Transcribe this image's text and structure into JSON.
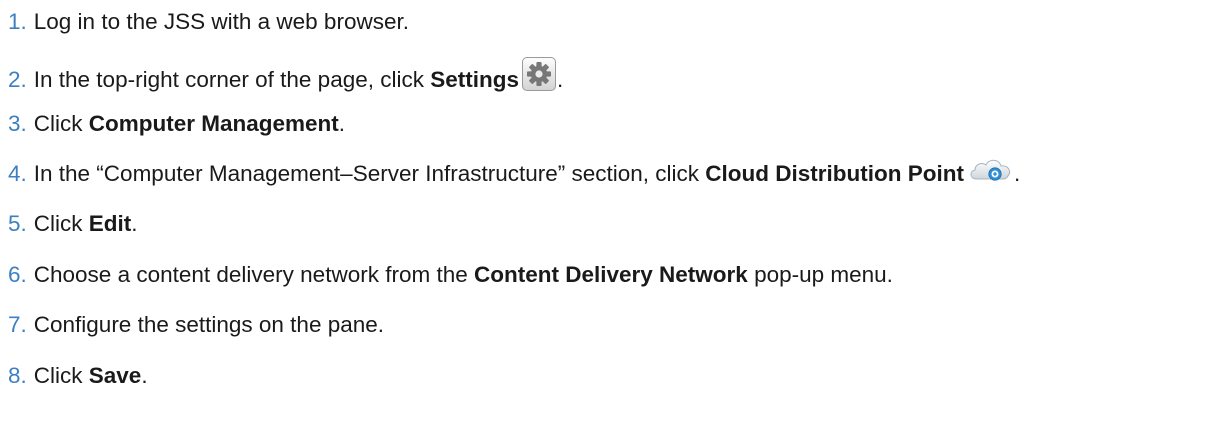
{
  "steps": [
    {
      "num": "1.",
      "parts": {
        "a": "Log in to the JSS with a web browser."
      }
    },
    {
      "num": "2.",
      "parts": {
        "a": "In the top-right corner of the page, click ",
        "b": "Settings",
        "c": "."
      }
    },
    {
      "num": "3.",
      "parts": {
        "a": "Click ",
        "b": "Computer Management",
        "c": "."
      }
    },
    {
      "num": "4.",
      "parts": {
        "a": "In the “Computer Management–Server Infrastructure” section, click ",
        "b": "Cloud Distribution Point",
        "c": "."
      }
    },
    {
      "num": "5.",
      "parts": {
        "a": "Click ",
        "b": "Edit",
        "c": "."
      }
    },
    {
      "num": "6.",
      "parts": {
        "a": "Choose a content delivery network from the ",
        "b": "Content Delivery Network",
        "c": " pop-up menu."
      }
    },
    {
      "num": "7.",
      "parts": {
        "a": "Configure the settings on the pane."
      }
    },
    {
      "num": "8.",
      "parts": {
        "a": "Click ",
        "b": "Save",
        "c": "."
      }
    }
  ],
  "icons": {
    "settings": "gear-icon",
    "cloud_distribution_point": "cloud-distribution-point-icon"
  },
  "colors": {
    "step_number": "#3d7fc1",
    "text": "#1a1a1a"
  }
}
